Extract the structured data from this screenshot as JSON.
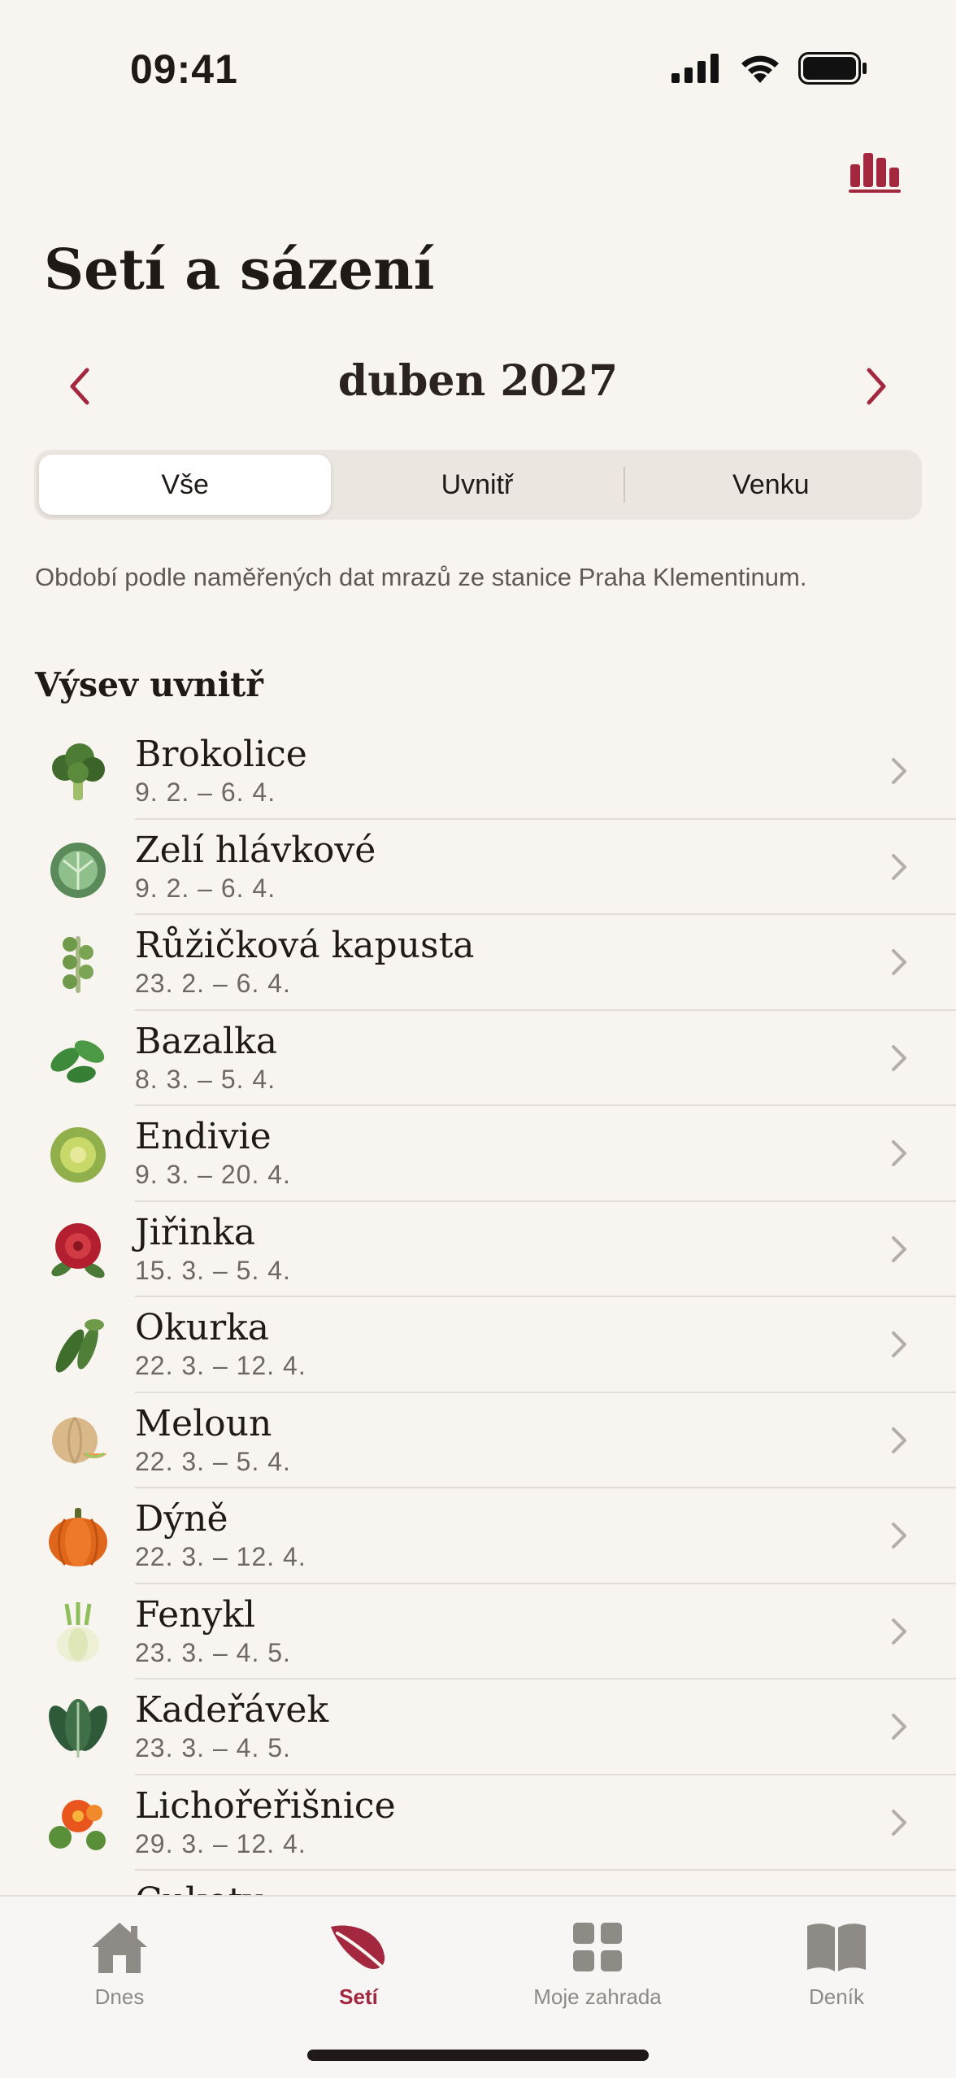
{
  "status": {
    "time": "09:41"
  },
  "header": {
    "stats_icon": "bar-chart-icon",
    "title": "Setí a sázení"
  },
  "month": {
    "label": "duben 2027",
    "prev_icon": "chevron-left-icon",
    "next_icon": "chevron-right-icon"
  },
  "segments": [
    {
      "label": "Vše",
      "active": true
    },
    {
      "label": "Uvnitř",
      "active": false
    },
    {
      "label": "Venku",
      "active": false
    }
  ],
  "note": "Období podle naměřených dat mrazů ze stanice Praha Klementinum.",
  "section": {
    "title": "Výsev uvnitř"
  },
  "items": [
    {
      "name": "Brokolice",
      "dates": "9. 2. – 6. 4.",
      "icon": "broccoli-icon"
    },
    {
      "name": "Zelí hlávkové",
      "dates": "9. 2. – 6. 4.",
      "icon": "cabbage-icon"
    },
    {
      "name": "Růžičková kapusta",
      "dates": "23. 2. – 6. 4.",
      "icon": "brussels-sprouts-icon"
    },
    {
      "name": "Bazalka",
      "dates": "8. 3. – 5. 4.",
      "icon": "basil-icon"
    },
    {
      "name": "Endivie",
      "dates": "9. 3. – 20. 4.",
      "icon": "endive-icon"
    },
    {
      "name": "Jiřinka",
      "dates": "15. 3. – 5. 4.",
      "icon": "dahlia-icon"
    },
    {
      "name": "Okurka",
      "dates": "22. 3. – 12. 4.",
      "icon": "cucumber-icon"
    },
    {
      "name": "Meloun",
      "dates": "22. 3. – 5. 4.",
      "icon": "melon-icon"
    },
    {
      "name": "Dýně",
      "dates": "22. 3. – 12. 4.",
      "icon": "pumpkin-icon"
    },
    {
      "name": "Fenykl",
      "dates": "23. 3. – 4. 5.",
      "icon": "fennel-icon"
    },
    {
      "name": "Kadeřávek",
      "dates": "23. 3. – 4. 5.",
      "icon": "kale-icon"
    },
    {
      "name": "Lichořeřišnice",
      "dates": "29. 3. – 12. 4.",
      "icon": "nasturtium-icon"
    },
    {
      "name": "Cukety",
      "dates": "",
      "icon": "zucchini-icon"
    }
  ],
  "tabs": [
    {
      "label": "Dnes",
      "icon": "home-icon",
      "active": false
    },
    {
      "label": "Setí",
      "icon": "leaf-icon",
      "active": true
    },
    {
      "label": "Moje zahrada",
      "icon": "grid-icon",
      "active": false
    },
    {
      "label": "Deník",
      "icon": "book-icon",
      "active": false
    }
  ],
  "colors": {
    "accent": "#a3283f",
    "background": "#f8f4ef",
    "inactive_tab": "#8e8a86"
  }
}
